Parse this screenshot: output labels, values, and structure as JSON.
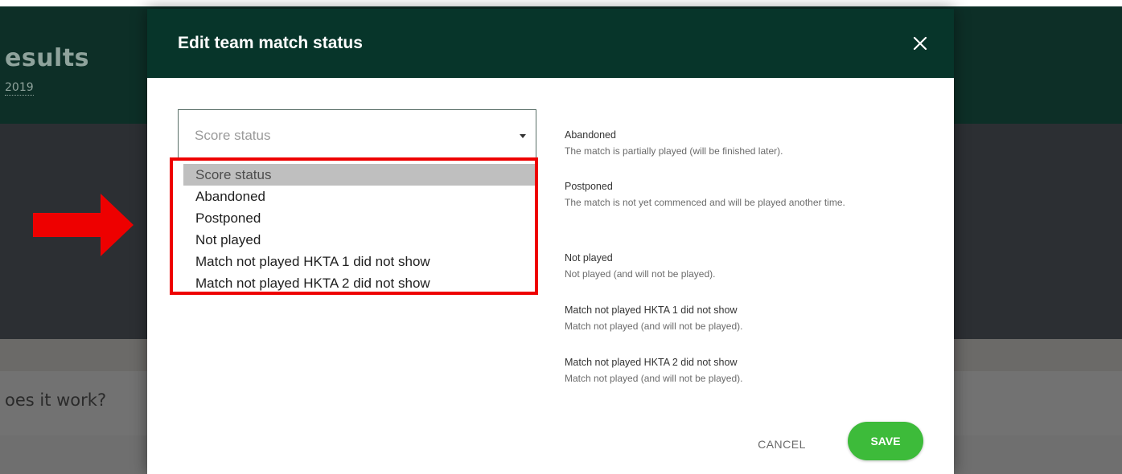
{
  "background": {
    "page_title": "esults",
    "date_text": "2019",
    "question_text": "oes it work?"
  },
  "modal": {
    "title": "Edit team match status",
    "close_icon": "close-icon",
    "select": {
      "placeholder": "Score status",
      "options": [
        "Score status",
        "Abandoned",
        "Postponed",
        "Not played",
        "Match not played HKTA 1 did not show",
        "Match not played HKTA 2 did not show"
      ],
      "highlighted_option_index": 0
    },
    "descriptions": [
      {
        "title": "Abandoned",
        "text": "The match is partially played (will be finished later)."
      },
      {
        "title": "Postponed",
        "text": "The match is not yet commenced and will be played another time."
      },
      {
        "title": "Not played",
        "text": "Not played (and will not be played)."
      },
      {
        "title": "Match not played HKTA 1 did not show",
        "text": "Match not played (and will not be played)."
      },
      {
        "title": "Match not played HKTA 2 did not show",
        "text": "Match not played (and will not be played)."
      }
    ],
    "cancel_label": "CANCEL",
    "save_label": "SAVE"
  },
  "colors": {
    "header_bg": "#07352a",
    "save_green": "#3dbb3a",
    "annotation_red": "#ee0000"
  }
}
